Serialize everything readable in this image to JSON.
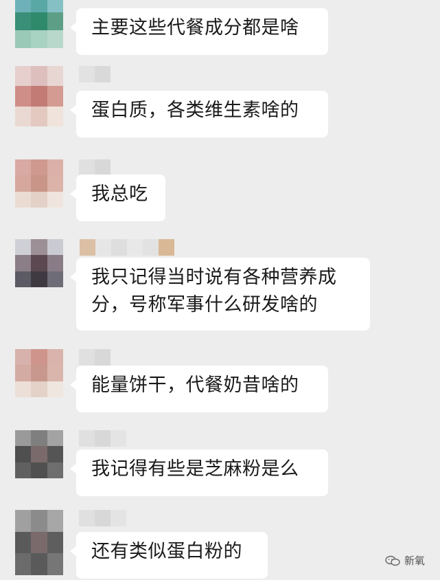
{
  "messages": [
    {
      "text": "主要这些代餐成分都是啥"
    },
    {
      "text": "蛋白质，各类维生素啥的"
    },
    {
      "text": "我总吃"
    },
    {
      "text": "我只记得当时说有各种营养成分，号称军事什么研发啥的"
    },
    {
      "text": "能量饼干，代餐奶昔啥的"
    },
    {
      "text": "我记得有些是芝麻粉是么"
    },
    {
      "text": "还有类似蛋白粉的"
    }
  ],
  "watermark": {
    "label": "新氧",
    "icon": "wechat-official-account-icon"
  }
}
